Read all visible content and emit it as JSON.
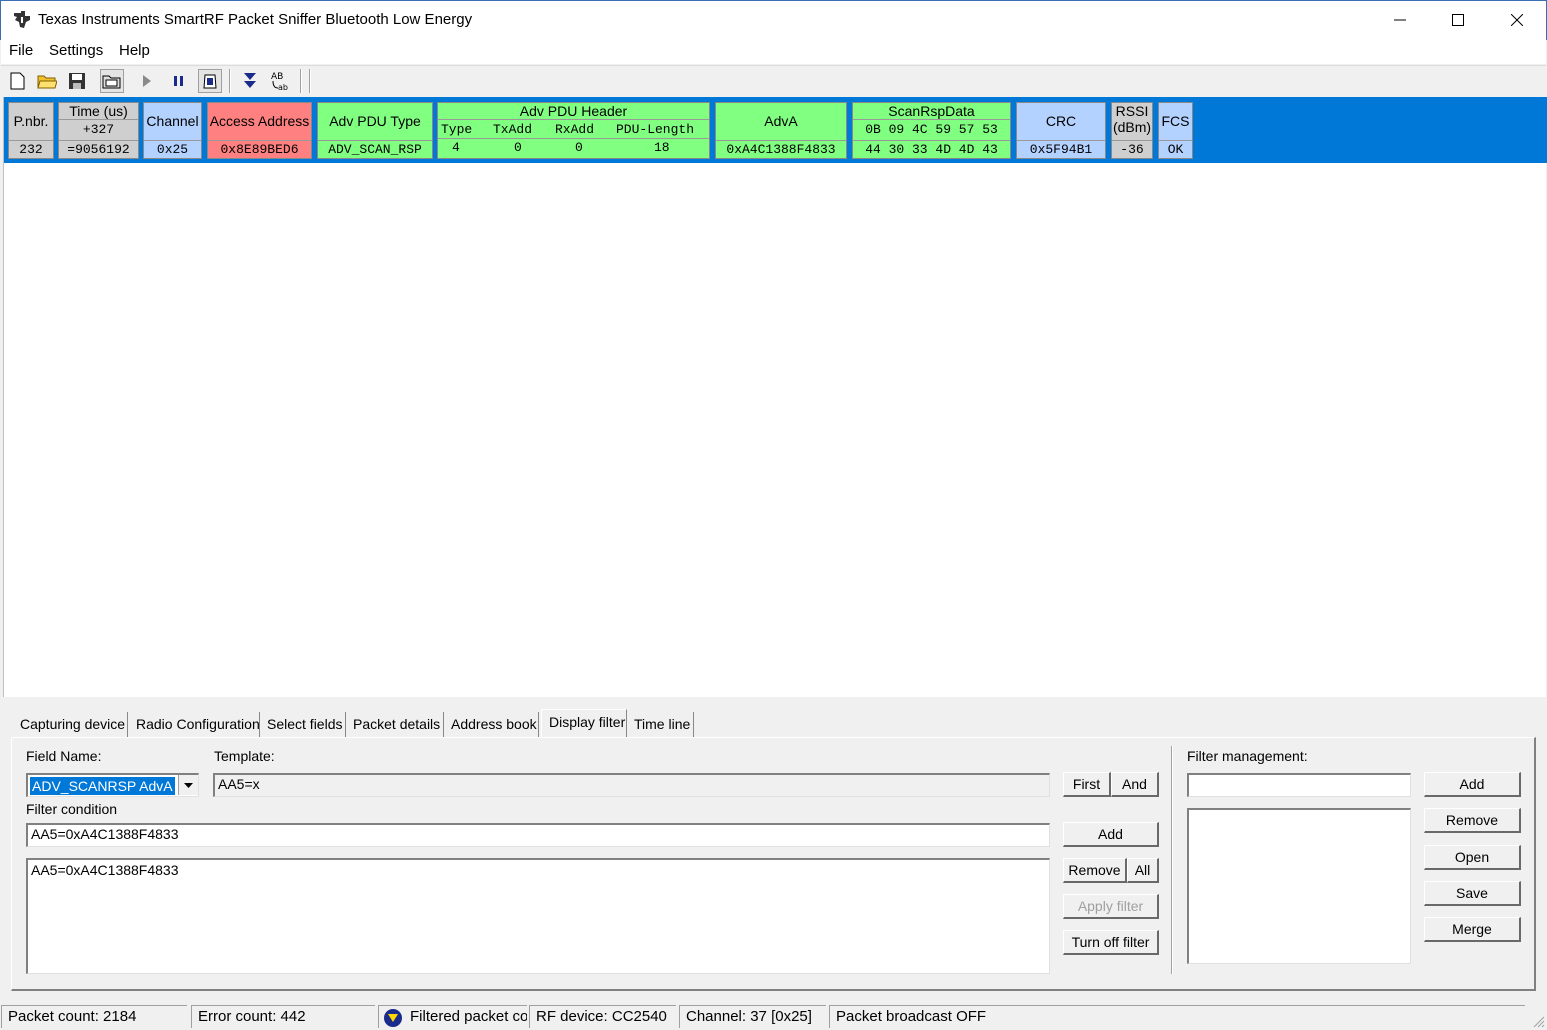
{
  "window": {
    "title": "Texas Instruments SmartRF Packet Sniffer Bluetooth Low Energy"
  },
  "menu": [
    "File",
    "Settings",
    "Help"
  ],
  "toolbar": {
    "icons": [
      "new-file-icon",
      "open-folder-icon",
      "save-icon",
      "open-file-icon",
      "play-icon",
      "pause-icon",
      "clear-icon",
      "autoscroll-icon",
      "text-format-icon"
    ]
  },
  "packet": {
    "pnbr": {
      "header": "P.nbr.",
      "value": "232"
    },
    "time": {
      "header": "Time (us)",
      "delta": "+327",
      "value": "=9056192"
    },
    "channel": {
      "header": "Channel",
      "value": "0x25"
    },
    "access_address": {
      "header": "Access Address",
      "value": "0x8E89BED6"
    },
    "adv_pdu_type": {
      "header": "Adv PDU Type",
      "value": "ADV_SCAN_RSP"
    },
    "adv_pdu_header": {
      "header": "Adv PDU Header",
      "subheaders": [
        "Type",
        "TxAdd",
        "RxAdd",
        "PDU-Length"
      ],
      "values": [
        "4",
        "0",
        "0",
        "18"
      ]
    },
    "adva": {
      "header": "AdvA",
      "value": "0xA4C1388F4833"
    },
    "scanrspdata": {
      "header": "ScanRspData",
      "line1": "0B 09 4C 59 57 53",
      "line2": "44 30 33 4D 4D 43"
    },
    "crc": {
      "header": "CRC",
      "value": "0x5F94B1"
    },
    "rssi": {
      "header1": "RSSI",
      "header2": "(dBm)",
      "value": "-36"
    },
    "fcs": {
      "header": "FCS",
      "value": "OK"
    }
  },
  "tabs": [
    "Capturing device",
    "Radio Configuration",
    "Select fields",
    "Packet details",
    "Address book",
    "Display filter",
    "Time line"
  ],
  "active_tab": "Display filter",
  "display_filter": {
    "field_name_label": "Field Name:",
    "field_name_value": "ADV_SCANRSP AdvA",
    "template_label": "Template:",
    "template_value": "AA5=x",
    "first_button": "First",
    "and_button": "And",
    "filter_condition_label": "Filter condition",
    "filter_condition_value": "AA5=0xA4C1388F4833",
    "add_button": "Add",
    "filter_list": [
      "AA5=0xA4C1388F4833"
    ],
    "remove_button": "Remove",
    "all_button": "All",
    "apply_filter_button": "Apply filter",
    "turn_off_filter_button": "Turn off filter"
  },
  "filter_management": {
    "label": "Filter management:",
    "input_value": "",
    "add_button": "Add",
    "remove_button": "Remove",
    "open_button": "Open",
    "save_button": "Save",
    "merge_button": "Merge"
  },
  "status": {
    "packet_count": "Packet count: 2184",
    "error_count": "Error count: 442",
    "filtered": "Filtered packet co",
    "rf_device": "RF device: CC2540",
    "channel": "Channel: 37 [0x25]",
    "broadcast": "Packet broadcast OFF"
  }
}
